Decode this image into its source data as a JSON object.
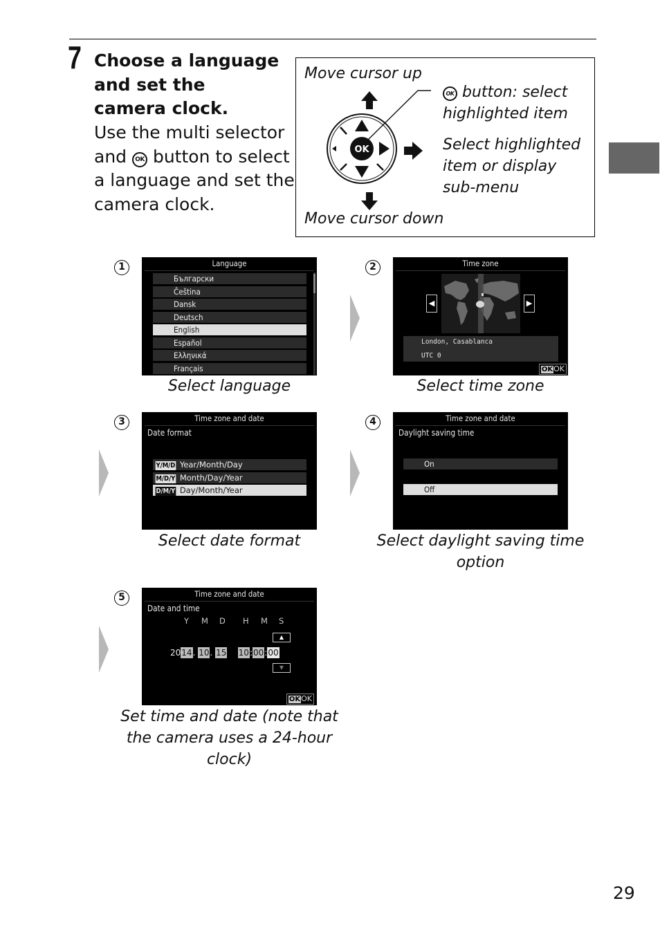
{
  "step": {
    "number": "7",
    "title": "Choose a language and set the camera clock.",
    "body_before_icon": "Use the multi selector and",
    "ok_icon_label": "OK",
    "body_after_icon": "button to select a language and set the camera clock."
  },
  "legend": {
    "move_up": "Move cursor up",
    "move_down": "Move cursor down",
    "ok_icon_label": "OK",
    "ok_description": "button: select highlighted item",
    "right_description": "Select highlighted item or display sub-menu",
    "dial_center_label": "OK"
  },
  "substeps": [
    {
      "badge": "1",
      "caption": "Select language",
      "screen": {
        "title": "Language",
        "items": [
          "Български",
          "Čeština",
          "Dansk",
          "Deutsch",
          "English",
          "Español",
          "Ελληνικά",
          "Français"
        ],
        "selected": "English"
      }
    },
    {
      "badge": "2",
      "caption": "Select time zone",
      "screen": {
        "title": "Time zone",
        "zone_name": "London, Casablanca",
        "utc_offset": "UTC 0",
        "ok_icon": "OK",
        "ok_label": "OK"
      }
    },
    {
      "badge": "3",
      "caption": "Select date format",
      "screen": {
        "title": "Time zone and date",
        "subtitle": "Date format",
        "items": [
          {
            "tag": "Y/M/D",
            "label": "Year/Month/Day"
          },
          {
            "tag": "M/D/Y",
            "label": "Month/Day/Year"
          },
          {
            "tag": "D/M/Y",
            "label": "Day/Month/Year"
          }
        ],
        "selected": "D/M/Y"
      }
    },
    {
      "badge": "4",
      "caption": "Select daylight saving time option",
      "screen": {
        "title": "Time zone and date",
        "subtitle": "Daylight saving time",
        "items": [
          "On",
          "Off"
        ],
        "selected": "Off"
      }
    },
    {
      "badge": "5",
      "caption": "Set time and date (note that the camera uses a 24-hour clock)",
      "screen": {
        "title": "Time zone and date",
        "subtitle": "Date and time",
        "column_labels": [
          "Y",
          "M",
          "D",
          "H",
          "M",
          "S"
        ],
        "year_prefix": "20",
        "year": "14",
        "month": "10",
        "day": "15",
        "hour": "10",
        "minute": "00",
        "second": "00",
        "active_field": "second",
        "ok_icon": "OK",
        "ok_label": "OK"
      }
    }
  ],
  "page_number": "29",
  "colors": {
    "side_tab": "#666666",
    "flow_arrow": "#b8b8b8",
    "screen_bg": "#000000",
    "row_bg": "#2b2b2b",
    "row_selected_bg": "#dedede"
  }
}
